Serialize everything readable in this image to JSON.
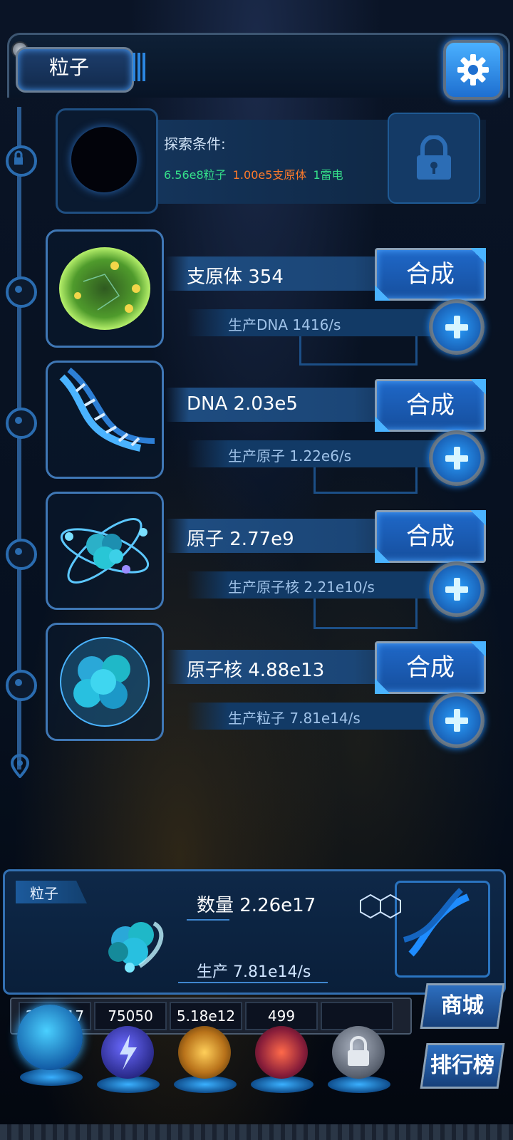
{
  "header": {
    "title": "粒子",
    "settings_icon": "gear-icon"
  },
  "explore": {
    "label": "探索条件:",
    "costs": [
      {
        "text": "6.56e8粒子",
        "color": "#35e08a"
      },
      {
        "text": "1.00e5支原体",
        "color": "#ff7a2a"
      },
      {
        "text": "1雷电",
        "color": "#35e08a"
      }
    ],
    "lock_icon": "padlock-icon"
  },
  "items": [
    {
      "name": "支原体 354",
      "production": "生产DNA 1416/s",
      "synth_label": "合成",
      "icon": "mycoplasma-cell-icon"
    },
    {
      "name": "DNA 2.03e5",
      "production": "生产原子 1.22e6/s",
      "synth_label": "合成",
      "icon": "dna-helix-icon"
    },
    {
      "name": "原子 2.77e9",
      "production": "生产原子核 2.21e10/s",
      "synth_label": "合成",
      "icon": "atom-icon"
    },
    {
      "name": "原子核 4.88e13",
      "production": "生产粒子 7.81e14/s",
      "synth_label": "合成",
      "icon": "nucleus-icon"
    }
  ],
  "summary": {
    "tag": "粒子",
    "count": "数量 2.26e17",
    "production": "生产 7.81e14/s",
    "icon": "particle-cluster-icon"
  },
  "resources": [
    "2.26e17",
    "75050",
    "5.18e12",
    "499",
    ""
  ],
  "side_buttons": {
    "shop": "商城",
    "ranking": "排行榜"
  }
}
